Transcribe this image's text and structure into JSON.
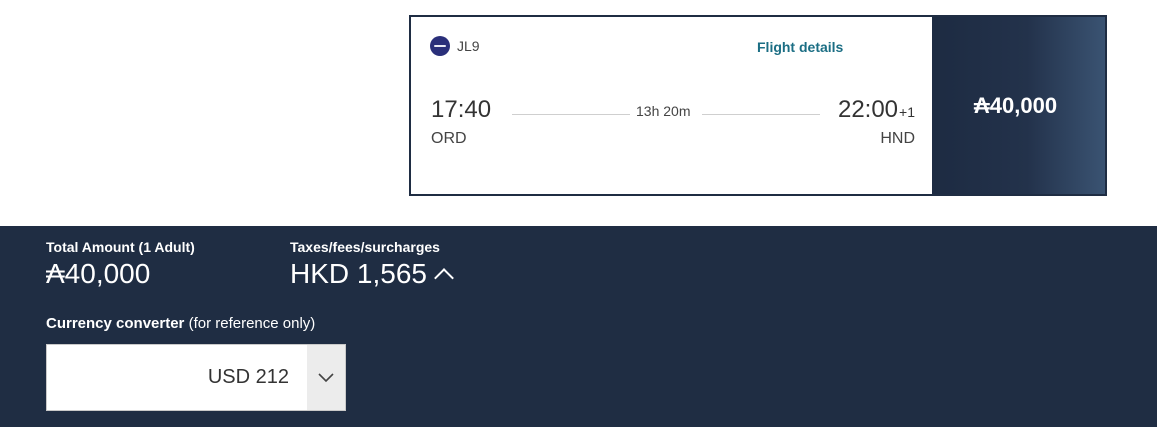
{
  "flight": {
    "airline_logo_icon": "japan-airlines-logo-icon",
    "flight_number": "JL9",
    "details_link": "Flight details",
    "departure": {
      "time": "17:40",
      "airport": "ORD"
    },
    "arrival": {
      "time": "22:00",
      "day_offset": "+1",
      "airport": "HND"
    },
    "duration": "13h 20m",
    "price": "₳40,000"
  },
  "summary": {
    "total_label": "Total Amount (1 Adult)",
    "total_amount": "₳40,000",
    "taxes_label": "Taxes/fees/surcharges",
    "taxes_amount": "HKD 1,565",
    "taxes_toggle_icon": "chevron-up-icon",
    "converter_label_strong": "Currency converter",
    "converter_label_rest": " (for reference only)",
    "converter_value": "USD 212",
    "converter_arrow_icon": "chevron-down-icon"
  },
  "colors": {
    "navy": "#1f2d43",
    "link_teal": "#1b6e84",
    "price_gradient_end": "#3a5372"
  }
}
